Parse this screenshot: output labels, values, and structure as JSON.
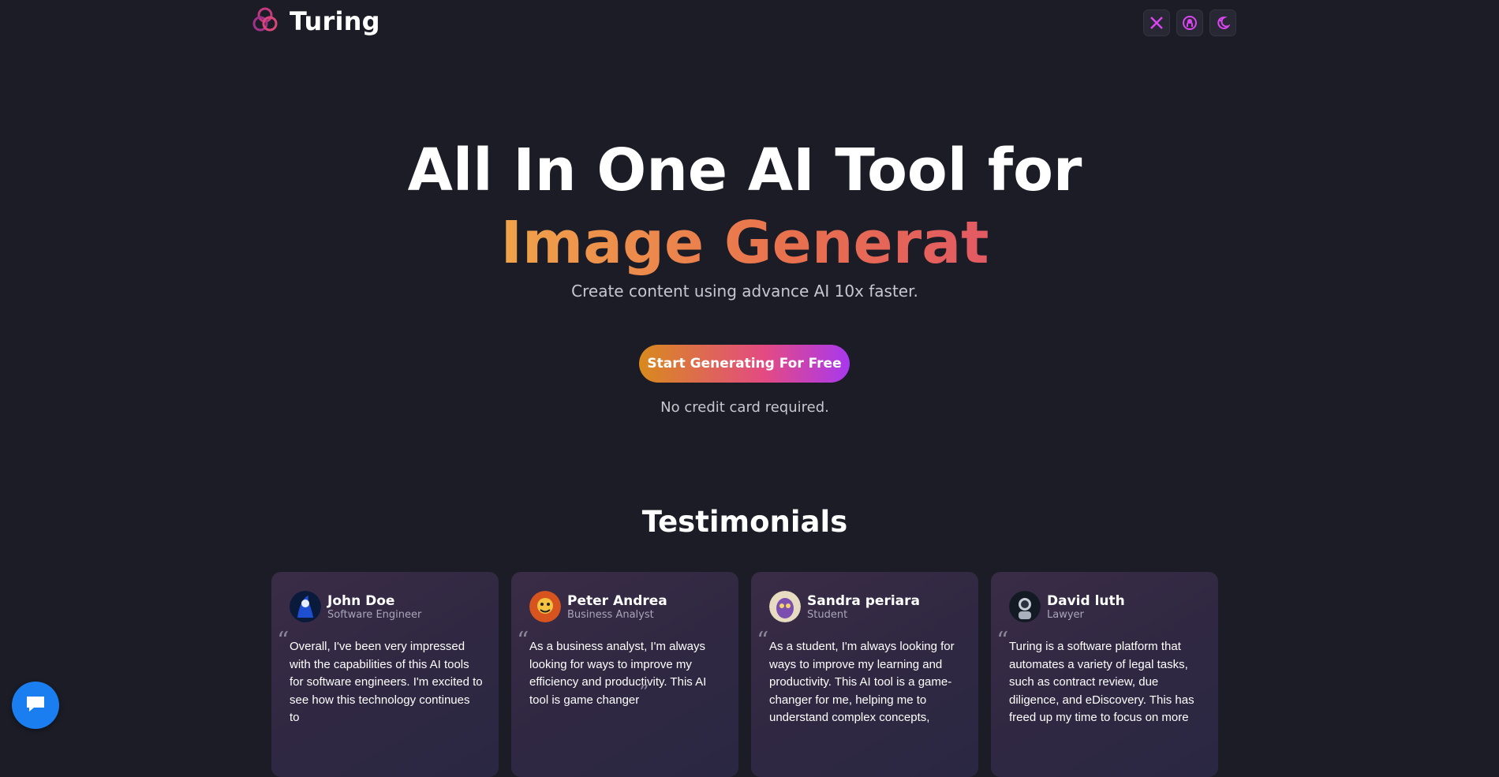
{
  "brand": {
    "name": "Turing"
  },
  "header": {
    "icons": [
      "x-icon",
      "github-icon",
      "theme-toggle-icon"
    ]
  },
  "hero": {
    "title_line1": "All In One AI Tool for",
    "title_line2": "Image Generat",
    "subtitle": "Create content using advance AI 10x faster.",
    "cta_label": "Start Generating For Free",
    "note": "No credit card required."
  },
  "testimonials": {
    "title": "Testimonials",
    "items": [
      {
        "name": "John Doe",
        "role": "Software Engineer",
        "quote": "Overall, I've been very impressed with the capabilities of this AI tools for software engineers. I'm excited to see how this technology continues to"
      },
      {
        "name": "Peter Andrea",
        "role": "Business Analyst",
        "quote": "As a business analyst, I'm always looking for ways to improve my efficiency and productivity. This AI tool is game changer"
      },
      {
        "name": "Sandra periara",
        "role": "Student",
        "quote": "As a student, I'm always looking for ways to improve my learning and productivity. This AI tool is a game-changer for me, helping me to understand complex concepts,"
      },
      {
        "name": "David luth",
        "role": "Lawyer",
        "quote": "Turing is a software platform that automates a variety of legal tasks, such as contract review, due diligence, and eDiscovery. This has freed up my time to focus on more"
      }
    ]
  },
  "colors": {
    "background": "#1b1c25",
    "accent_pink": "#e34a83",
    "chat_blue": "#1b7ef0"
  }
}
